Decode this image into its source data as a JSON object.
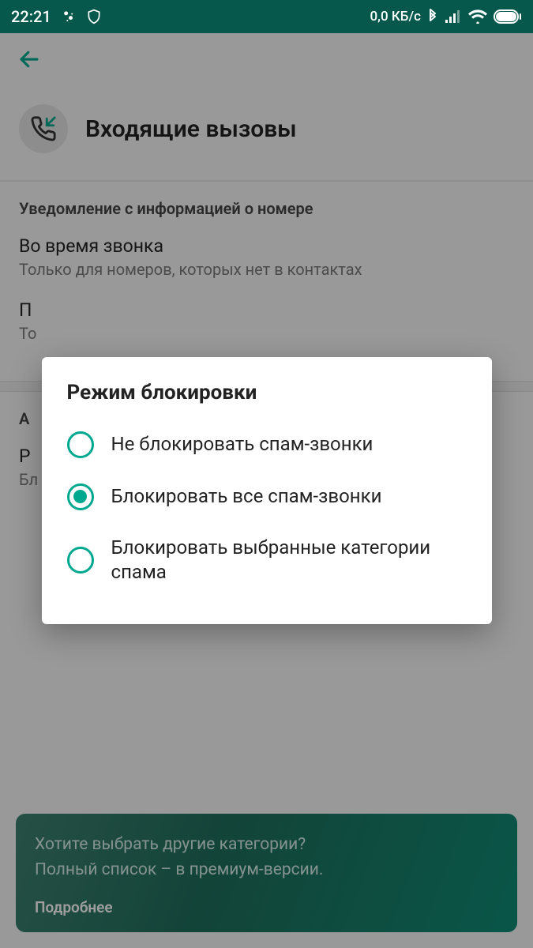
{
  "statusbar": {
    "time": "22:21",
    "data_rate": "0,0 КБ/с"
  },
  "toolbar": {},
  "header": {
    "title": "Входящие вызовы"
  },
  "notif_section": {
    "heading": "Уведомление с информацией о номере",
    "item1": {
      "title": "Во время звонка",
      "sub": "Только для номеров, которых нет в контактах"
    },
    "item2": {
      "title": "П",
      "sub": "То"
    }
  },
  "auto_section": {
    "heading": "А",
    "item1": {
      "title": "Р",
      "sub": "Бл"
    }
  },
  "banner": {
    "line1": "Хотите выбрать другие категории?",
    "line2": "Полный список – в премиум-версии.",
    "more": "Подробнее"
  },
  "dialog": {
    "title": "Режим блокировки",
    "options": [
      {
        "label": "Не блокировать спам-звонки",
        "selected": false
      },
      {
        "label": "Блокировать все спам-звонки",
        "selected": true
      },
      {
        "label": "Блокировать выбранные категории спама",
        "selected": false
      }
    ]
  }
}
